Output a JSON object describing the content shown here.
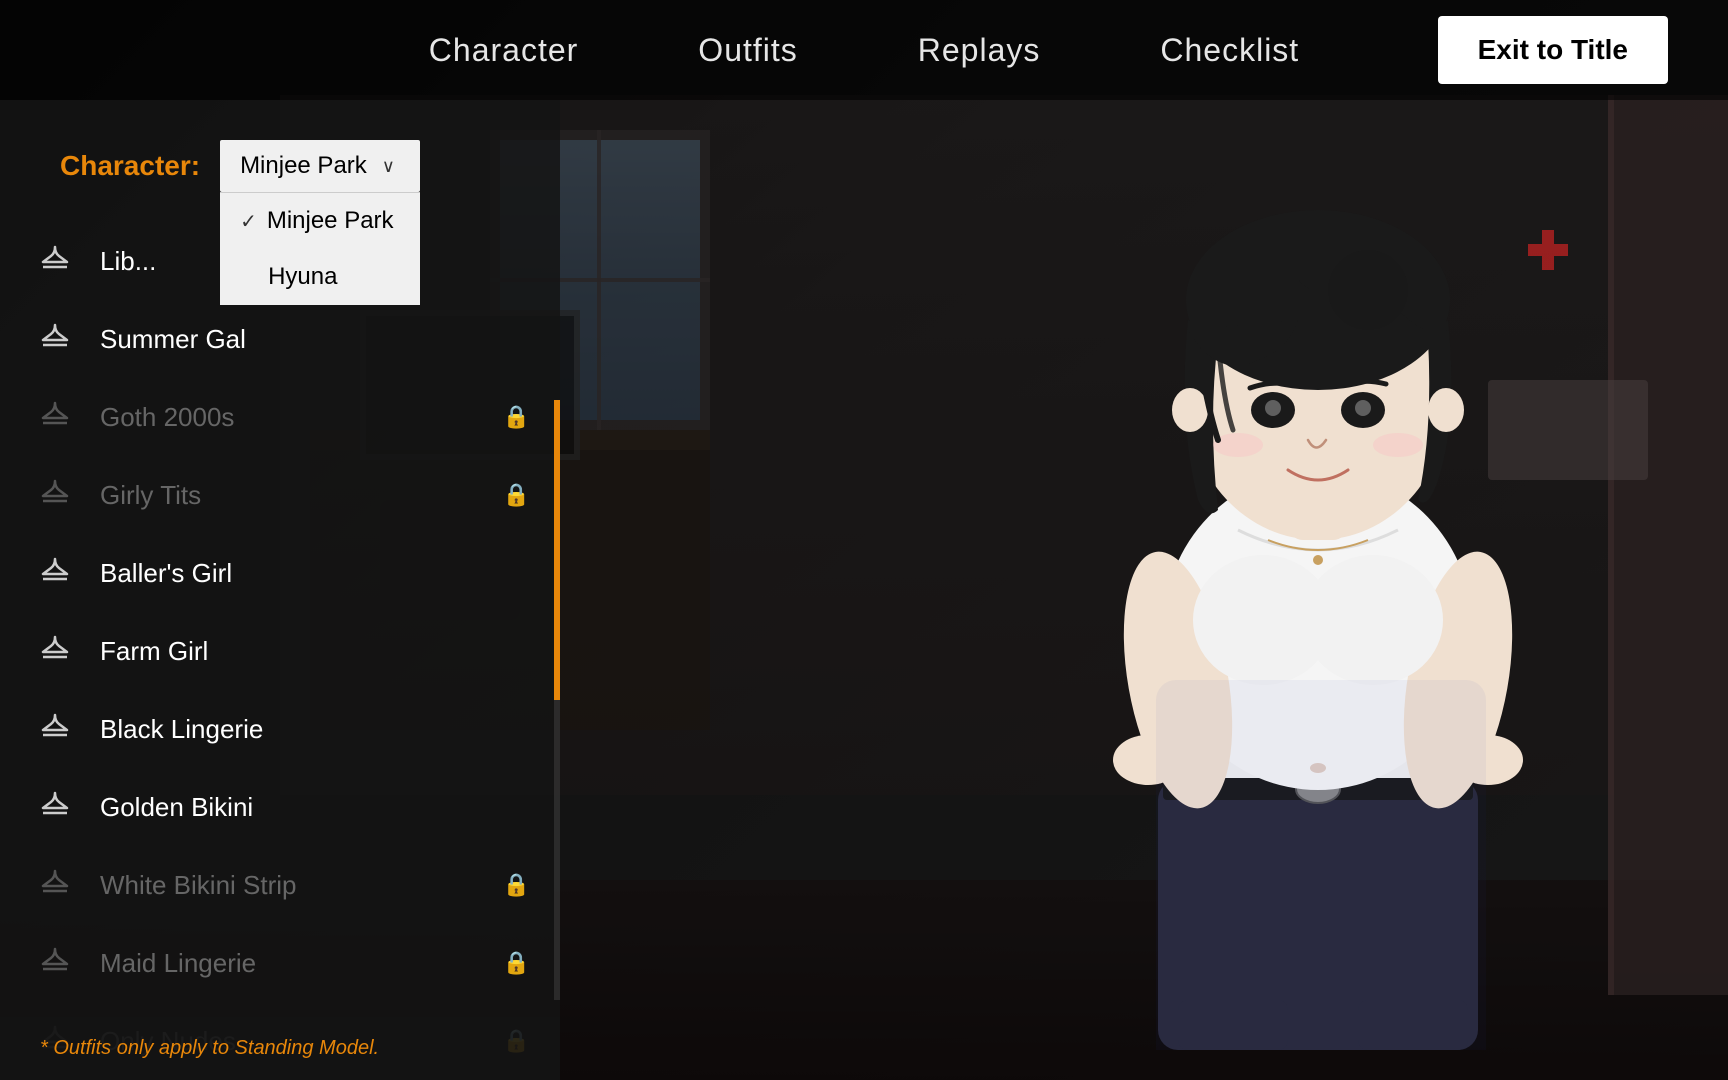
{
  "topbar": {
    "nav_items": [
      {
        "id": "character",
        "label": "Character"
      },
      {
        "id": "outfits",
        "label": "Outfits"
      },
      {
        "id": "replays",
        "label": "Replays"
      },
      {
        "id": "checklist",
        "label": "Checklist"
      }
    ],
    "exit_button_label": "Exit to Title"
  },
  "character_selector": {
    "label": "Character:",
    "selected": "Minjee Park",
    "options": [
      {
        "label": "Minjee Park",
        "selected": true
      },
      {
        "label": "Hyuna",
        "selected": false
      }
    ],
    "dropdown_open": true
  },
  "outfit_list": [
    {
      "id": "lib",
      "name": "Lib...",
      "locked": false,
      "active": false
    },
    {
      "id": "summer-gal",
      "name": "Summer Gal",
      "locked": false,
      "active": false
    },
    {
      "id": "goth-2000s",
      "name": "Goth 2000s",
      "locked": true,
      "active": false
    },
    {
      "id": "girly-tits",
      "name": "Girly Tits",
      "locked": true,
      "active": false
    },
    {
      "id": "ballers-girl",
      "name": "Baller's Girl",
      "locked": false,
      "active": false
    },
    {
      "id": "farm-girl",
      "name": "Farm Girl",
      "locked": false,
      "active": false
    },
    {
      "id": "black-lingerie",
      "name": "Black Lingerie",
      "locked": false,
      "active": false
    },
    {
      "id": "golden-bikini",
      "name": "Golden Bikini",
      "locked": false,
      "active": false
    },
    {
      "id": "white-bikini-strip",
      "name": "White Bikini Strip",
      "locked": true,
      "active": false
    },
    {
      "id": "maid-lingerie",
      "name": "Maid Lingerie",
      "locked": true,
      "active": false
    },
    {
      "id": "only-nudes",
      "name": "Only Nudes",
      "locked": true,
      "active": false
    }
  ],
  "footer": {
    "note": "* Outfits only apply to Standing Model."
  },
  "colors": {
    "accent": "#e8870a",
    "background": "#1a1a1a",
    "panel_bg": "rgba(20,20,20,0.85)",
    "text_primary": "#ffffff",
    "text_locked": "#666666",
    "dropdown_bg": "#f0f0f0",
    "exit_btn_bg": "#ffffff",
    "exit_btn_text": "#000000"
  },
  "icons": {
    "hanger": "⊂",
    "lock": "🔒",
    "check": "✓",
    "chevron_down": "∨"
  }
}
